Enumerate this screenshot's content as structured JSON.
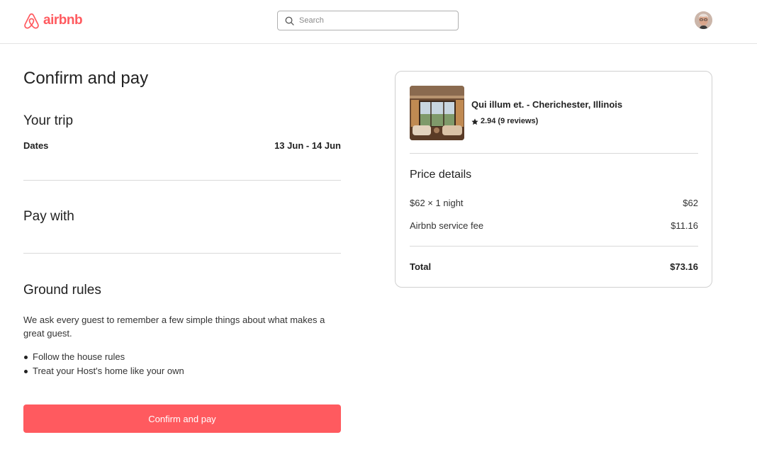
{
  "header": {
    "logo_text": "airbnb",
    "search_placeholder": "Search",
    "brand_color": "#FF5A5F"
  },
  "main": {
    "title": "Confirm and pay",
    "trip": {
      "heading": "Your trip",
      "dates_label": "Dates",
      "dates_value": "13 Jun - 14 Jun"
    },
    "pay_with": {
      "heading": "Pay with"
    },
    "ground_rules": {
      "heading": "Ground rules",
      "description": "We ask every guest to remember a few simple things about what makes a great guest.",
      "items": [
        "Follow the house rules",
        "Treat your Host's home like your own"
      ]
    },
    "confirm_button_label": "Confirm and pay"
  },
  "listing": {
    "title": "Qui illum et. - Cherichester, Illinois",
    "rating": "2.94",
    "reviews": "(9 reviews)"
  },
  "price_details": {
    "heading": "Price details",
    "lines": [
      {
        "label": "$62 × 1 night",
        "value": "$62"
      },
      {
        "label": "Airbnb service fee",
        "value": "$11.16"
      }
    ],
    "total_label": "Total",
    "total_value": "$73.16"
  }
}
